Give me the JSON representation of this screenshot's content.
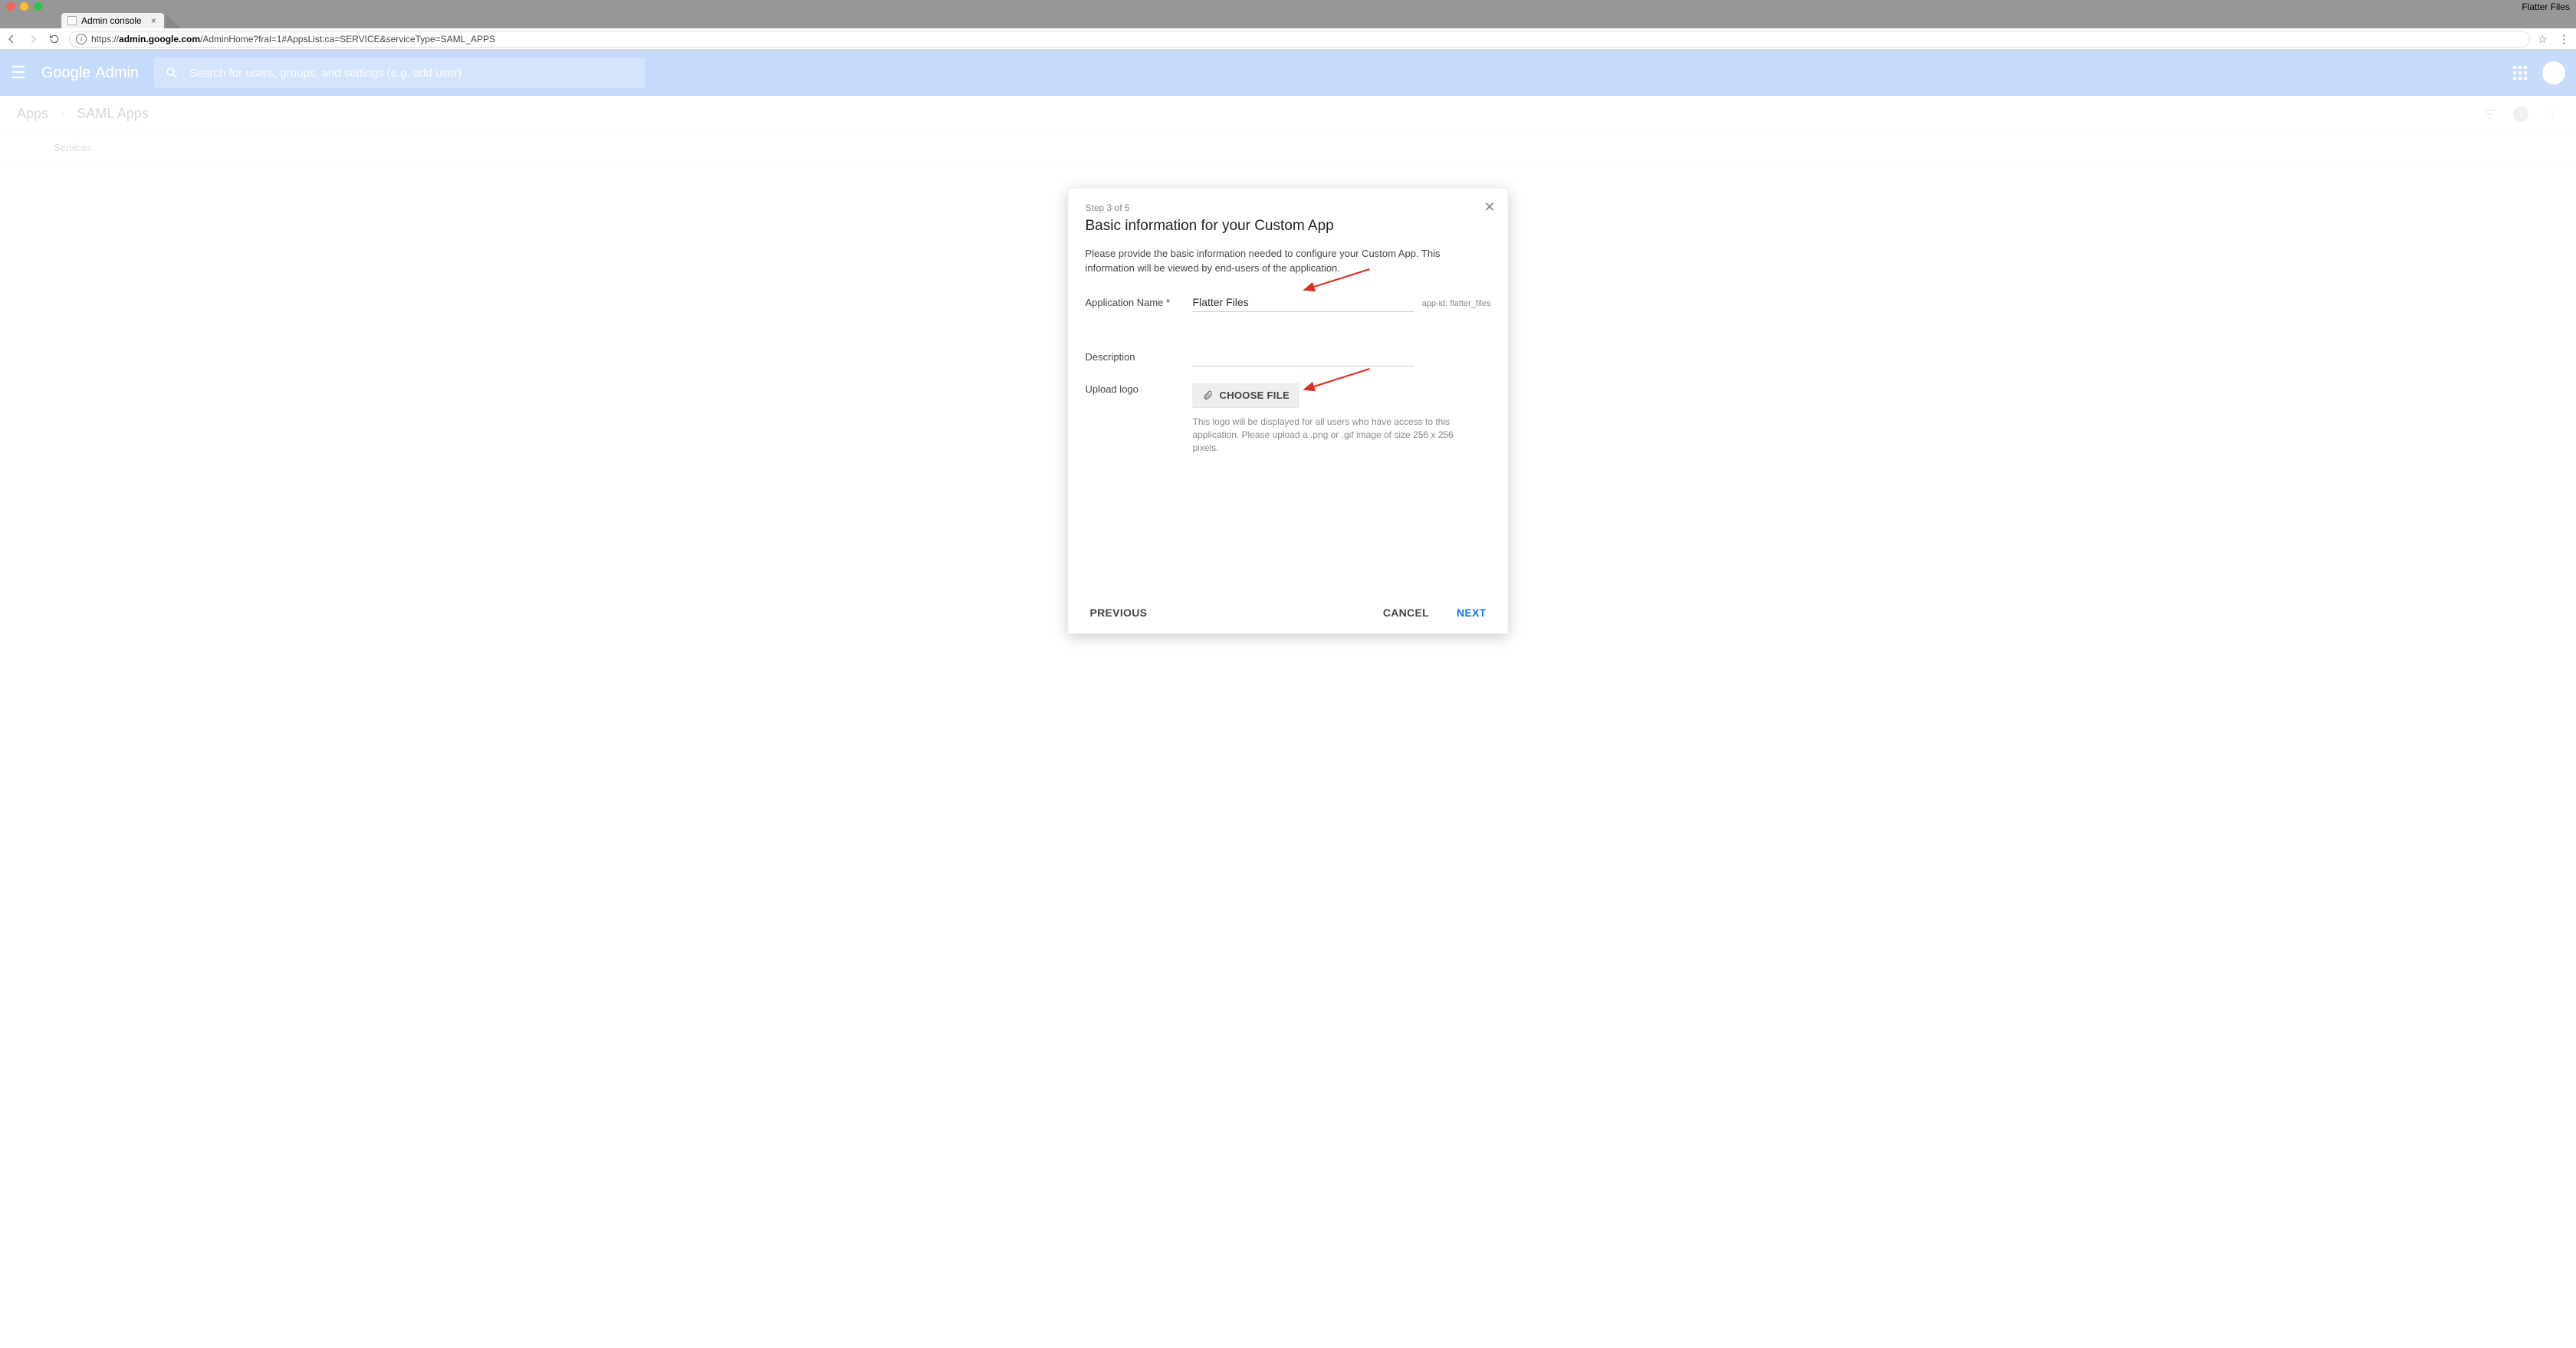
{
  "os": {
    "menu_app": "Flatter Files"
  },
  "browser": {
    "tab_title": "Admin console",
    "url_prefix": "https://",
    "url_host": "admin.google.com",
    "url_path": "/AdminHome?fral=1#AppsList:ca=SERVICE&serviceType=SAML_APPS"
  },
  "gbar": {
    "logo_left": "Google",
    "logo_right": "Admin",
    "search_placeholder": "Search for users, groups, and settings (e.g. add user)"
  },
  "crumbs": {
    "a": "Apps",
    "b": "SAML Apps"
  },
  "table": {
    "col0": "Services"
  },
  "modal": {
    "step": "Step 3 of 5",
    "title": "Basic information for your Custom App",
    "desc": "Please provide the basic information needed to configure your Custom App. This information will be viewed by end-users of the application.",
    "app_name_label": "Application Name *",
    "app_name_value": "Flatter Files",
    "app_id_label": "app-id:",
    "app_id_value": "flatter_files",
    "description_label": "Description",
    "description_value": "",
    "upload_label": "Upload logo",
    "choose_file": "CHOOSE FILE",
    "hint": "This logo will be displayed for all users who have access to this application. Please upload a .png or .gif image of size 256 x 256 pixels.",
    "prev": "PREVIOUS",
    "cancel": "CANCEL",
    "next": "NEXT"
  }
}
